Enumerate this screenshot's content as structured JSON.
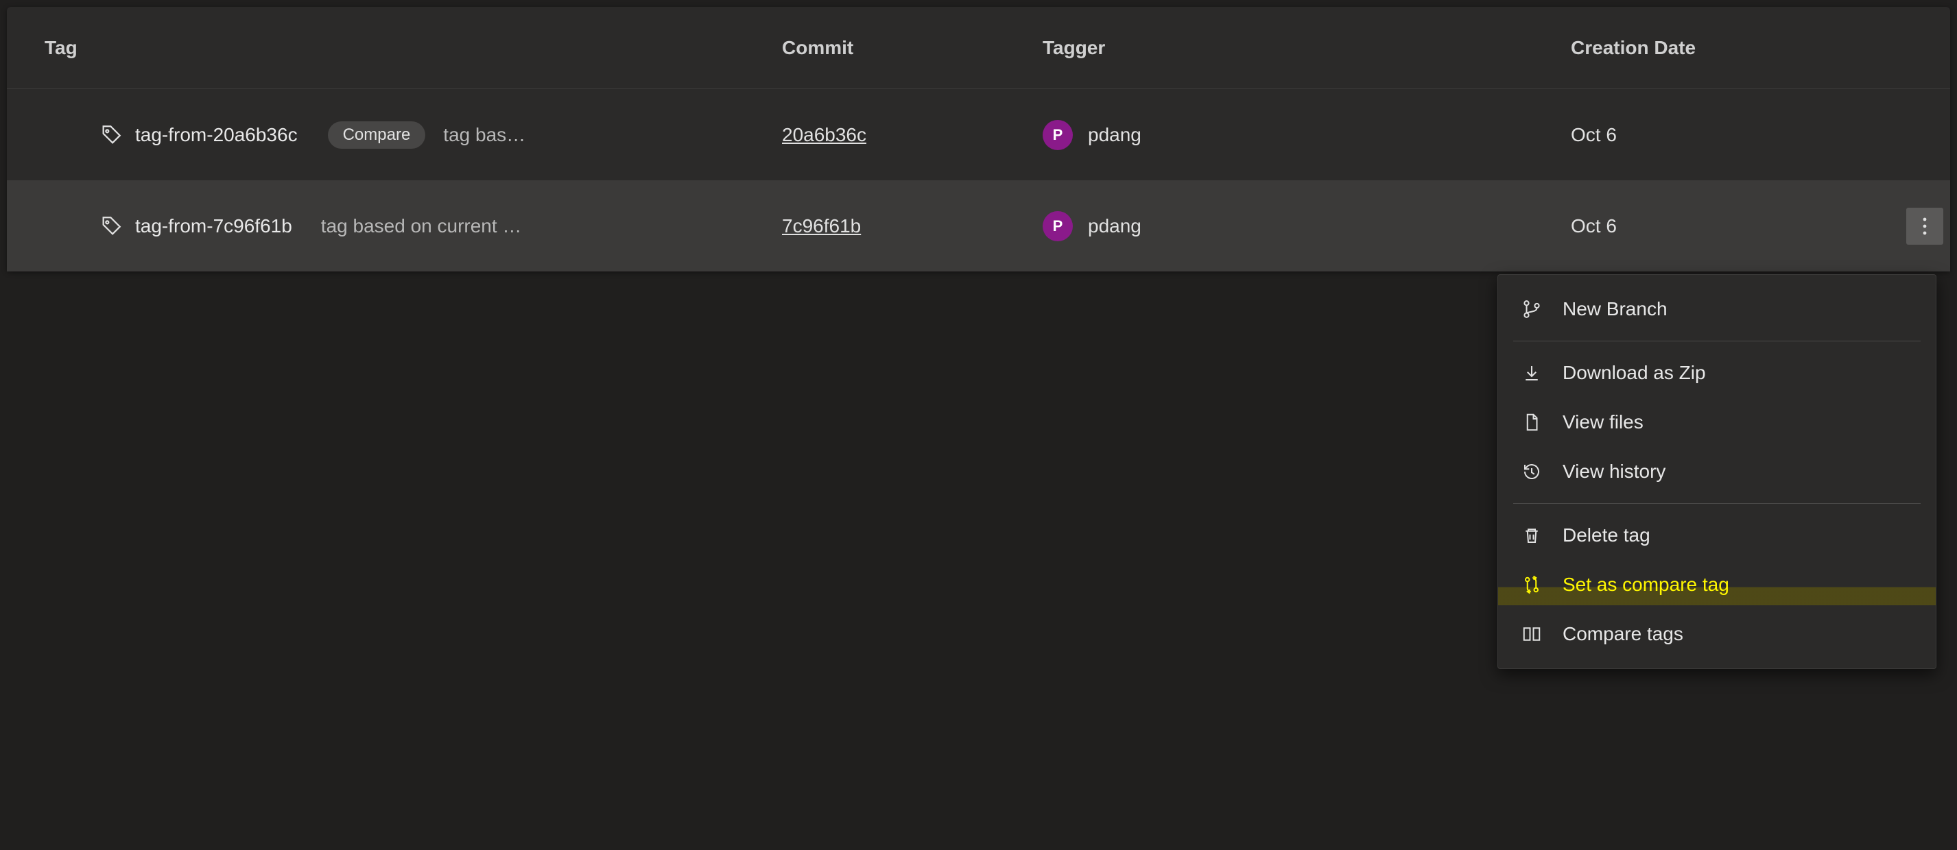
{
  "columns": {
    "tag": "Tag",
    "commit": "Commit",
    "tagger": "Tagger",
    "creation_date": "Creation Date"
  },
  "rows": [
    {
      "name": "tag-from-20a6b36c",
      "compare_label": "Compare",
      "description": "tag bas…",
      "commit": "20a6b36c",
      "tagger_initial": "P",
      "tagger_name": "pdang",
      "date": "Oct 6"
    },
    {
      "name": "tag-from-7c96f61b",
      "description": "tag based on current …",
      "commit": "7c96f61b",
      "tagger_initial": "P",
      "tagger_name": "pdang",
      "date": "Oct 6"
    }
  ],
  "menu": {
    "new_branch": "New Branch",
    "download_zip": "Download as Zip",
    "view_files": "View files",
    "view_history": "View history",
    "delete_tag": "Delete tag",
    "set_compare": "Set as compare tag",
    "compare_tags": "Compare tags"
  }
}
